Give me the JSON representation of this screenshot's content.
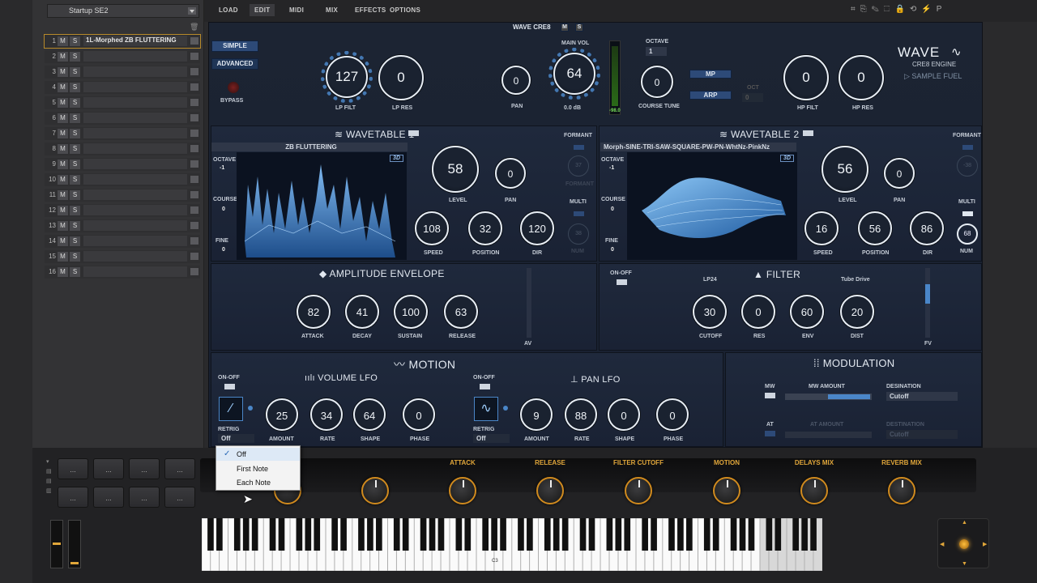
{
  "preset": "Startup SE2",
  "tabs": [
    "LOAD",
    "EDIT",
    "MIDI",
    "MIX",
    "EFFECTS",
    "OPTIONS"
  ],
  "slots": [
    {
      "n": "1",
      "name": "1L-Morphed ZB FLUTTERING"
    },
    {
      "n": "2",
      "name": ""
    },
    {
      "n": "3",
      "name": ""
    },
    {
      "n": "4",
      "name": ""
    },
    {
      "n": "5",
      "name": ""
    },
    {
      "n": "6",
      "name": ""
    },
    {
      "n": "7",
      "name": ""
    },
    {
      "n": "8",
      "name": ""
    },
    {
      "n": "9",
      "name": ""
    },
    {
      "n": "10",
      "name": ""
    },
    {
      "n": "11",
      "name": ""
    },
    {
      "n": "12",
      "name": ""
    },
    {
      "n": "13",
      "name": ""
    },
    {
      "n": "14",
      "name": ""
    },
    {
      "n": "15",
      "name": ""
    },
    {
      "n": "16",
      "name": ""
    }
  ],
  "slot_m": "M",
  "slot_s": "S",
  "engine": {
    "title": "WAVE CRE8",
    "m": "M",
    "s": "S",
    "logo": "WAVE",
    "sub": "CRE8 ENGINE",
    "brand": "SAMPLE FUEL"
  },
  "modes": {
    "simple": "SIMPLE",
    "advanced": "ADVANCED",
    "bypass": "BYPASS"
  },
  "top": {
    "lp_filt": {
      "v": "127",
      "l": "LP FILT"
    },
    "lp_res": {
      "v": "0",
      "l": "LP RES"
    },
    "pan": {
      "v": "0",
      "l": "PAN"
    },
    "main_vol": {
      "v": "64",
      "l": "0.0 dB",
      "t": "MAIN VOL"
    },
    "meter": "-98.0",
    "octave": {
      "t": "OCTAVE",
      "v": "1"
    },
    "course": {
      "v": "0",
      "l": "COURSE TUNE"
    },
    "mp": "MP",
    "arp": "ARP",
    "oct": "OCT",
    "oct_v": "0",
    "hp_filt": {
      "v": "0",
      "l": "HP FILT"
    },
    "hp_res": {
      "v": "0",
      "l": "HP RES"
    }
  },
  "wt1": {
    "title": "WAVETABLE 1",
    "src": "ZB FLUTTERING",
    "octave": "OCTAVE",
    "oct_v": "-1",
    "course": "COURSE",
    "course_v": "0",
    "fine": "FINE",
    "fine_v": "0",
    "badge": "3D",
    "level": {
      "v": "58",
      "l": "LEVEL"
    },
    "pan": {
      "v": "0",
      "l": "PAN"
    },
    "speed": {
      "v": "108",
      "l": "SPEED"
    },
    "pos": {
      "v": "32",
      "l": "POSITION"
    },
    "dir": {
      "v": "120",
      "l": "DIR"
    },
    "formant": "FORMANT",
    "f_v": "37",
    "f_l": "FORMANT",
    "multi": "MULTI",
    "m_v": "38",
    "m_l": "NUM"
  },
  "wt2": {
    "title": "WAVETABLE 2",
    "src": "Morph-SINE-TRI-SAW-SQUARE-PW-PN-WhtNz-PinkNz",
    "octave": "OCTAVE",
    "oct_v": "-1",
    "course": "COURSE",
    "course_v": "0",
    "fine": "FINE",
    "fine_v": "0",
    "badge": "3D",
    "level": {
      "v": "56",
      "l": "LEVEL"
    },
    "pan": {
      "v": "0",
      "l": "PAN"
    },
    "speed": {
      "v": "16",
      "l": "SPEED"
    },
    "pos": {
      "v": "56",
      "l": "POSITION"
    },
    "dir": {
      "v": "86",
      "l": "DIR"
    },
    "formant": "FORMANT",
    "f_v": "-38",
    "multi": "MULTI",
    "m_v": "68",
    "m_l": "NUM"
  },
  "amp": {
    "title": "AMPLITUDE ENVELOPE",
    "attack": {
      "v": "82",
      "l": "ATTACK"
    },
    "decay": {
      "v": "41",
      "l": "DECAY"
    },
    "sustain": {
      "v": "100",
      "l": "SUSTAIN"
    },
    "release": {
      "v": "63",
      "l": "RELEASE"
    },
    "av": "AV"
  },
  "filter": {
    "title": "FILTER",
    "onoff": "ON-OFF",
    "type": "LP24",
    "drive": "Tube Drive",
    "cutoff": {
      "v": "30",
      "l": "CUTOFF"
    },
    "res": {
      "v": "0",
      "l": "RES"
    },
    "env": {
      "v": "60",
      "l": "ENV"
    },
    "dist": {
      "v": "20",
      "l": "DIST"
    },
    "fv": "FV"
  },
  "motion": {
    "title": "MOTION",
    "vol": {
      "title": "VOLUME LFO",
      "onoff": "ON-OFF",
      "retrig": "RETRIG",
      "retrig_v": "Off",
      "amount": {
        "v": "25",
        "l": "AMOUNT"
      },
      "rate": {
        "v": "34",
        "l": "RATE"
      },
      "shape": {
        "v": "64",
        "l": "SHAPE"
      },
      "phase": {
        "v": "0",
        "l": "PHASE"
      }
    },
    "pan": {
      "title": "PAN LFO",
      "onoff": "ON-OFF",
      "retrig": "RETRIG",
      "retrig_v": "Off",
      "amount": {
        "v": "9",
        "l": "AMOUNT"
      },
      "rate": {
        "v": "88",
        "l": "RATE"
      },
      "shape": {
        "v": "0",
        "l": "SHAPE"
      },
      "phase": {
        "v": "0",
        "l": "PHASE"
      }
    }
  },
  "mod": {
    "title": "MODULATION",
    "mw": "MW",
    "mw_amt": "MW AMOUNT",
    "dest": "DESINATION",
    "dest_v": "Cutoff",
    "at": "AT",
    "at_amt": "AT AMOUNT",
    "dest2": "DESTINATION",
    "dest2_v": "Cutoff"
  },
  "menu": [
    "Off",
    "First Note",
    "Each Note"
  ],
  "macros": [
    "ATTACK",
    "RELEASE",
    "FILTER CUTOFF",
    "MOTION",
    "DELAYS MIX",
    "REVERB MIX"
  ],
  "pad_label": "...",
  "key_label": "C3",
  "colors": {
    "accent": "#4a86c8",
    "macro": "#e0a63a"
  }
}
